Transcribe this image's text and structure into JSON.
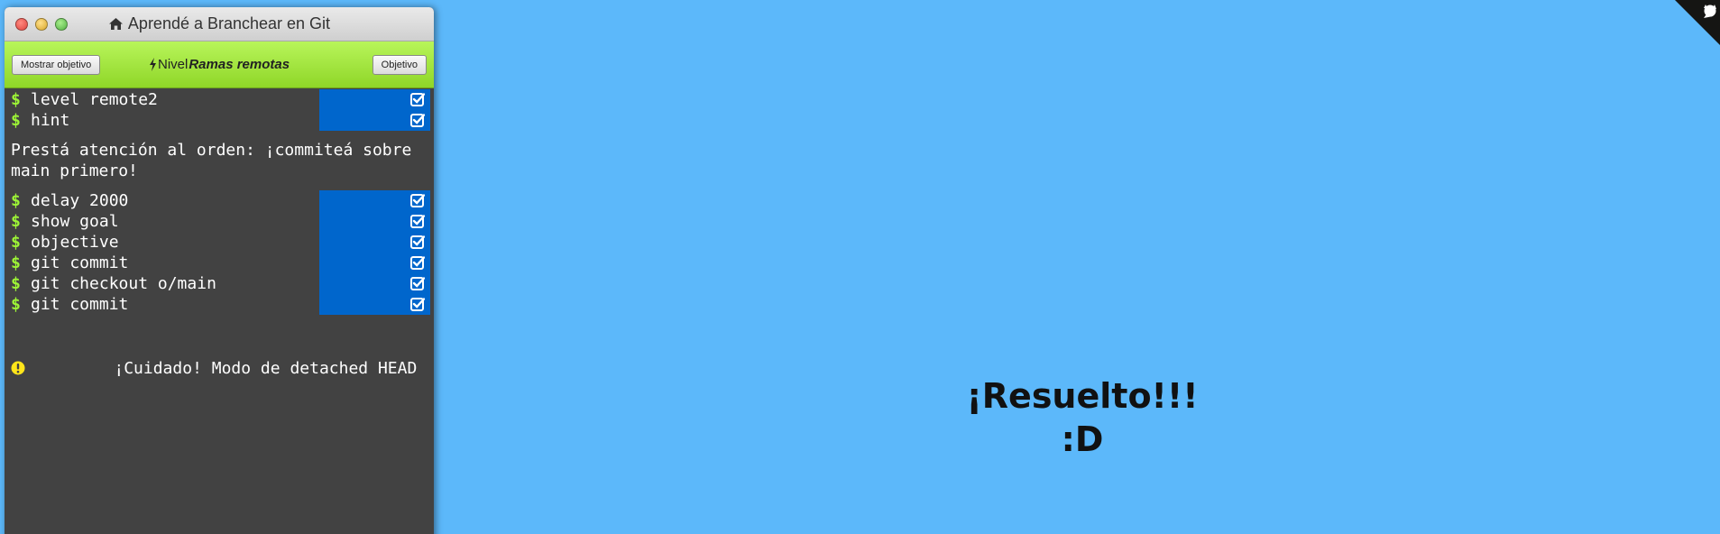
{
  "window": {
    "title": "Aprendé a Branchear en Git",
    "home_icon": "home-icon"
  },
  "toolbar": {
    "show_goal_label": "Mostrar objetivo",
    "level_prefix": "Nivel",
    "level_name": "Ramas remotas",
    "objective_label": "Objetivo"
  },
  "terminal": {
    "prompt": "$",
    "commands_a": [
      {
        "text": "level remote2"
      },
      {
        "text": "hint"
      }
    ],
    "hint": "Prestá atención al orden: ¡commiteá sobre main primero!",
    "commands_b": [
      {
        "text": "delay 2000"
      },
      {
        "text": "show goal"
      },
      {
        "text": "objective"
      },
      {
        "text": "git commit"
      },
      {
        "text": "git checkout o/main"
      },
      {
        "text": "git commit"
      }
    ],
    "warning": "¡Cuidado! Modo de detached HEAD"
  },
  "canvas": {
    "result_line1": "¡Resuelto!!!",
    "result_line2": ":D"
  },
  "colors": {
    "background": "#5cb8fa",
    "toolbar": "#9ee23a",
    "status_done": "#0066cc",
    "prompt": "#9ef536",
    "warning": "#ffe51a"
  }
}
